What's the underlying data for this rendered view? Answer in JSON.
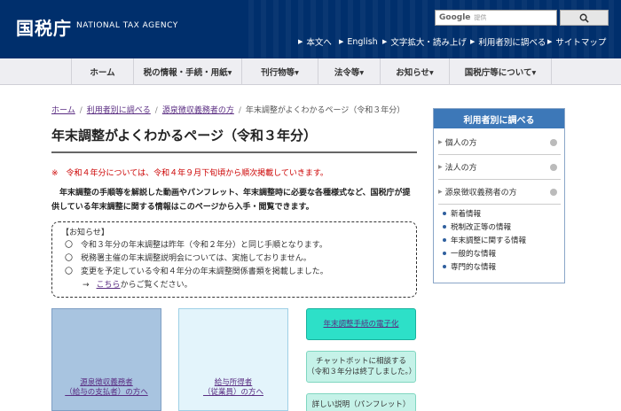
{
  "header": {
    "logo_jp": "国税庁",
    "logo_en": "NATIONAL TAX AGENCY",
    "search_brand": "Google",
    "search_placeholder": "提供",
    "util_links": [
      {
        "label": "本文へ"
      },
      {
        "label": "English"
      },
      {
        "label": "文字拡大・読み上げ"
      },
      {
        "label": "利用者別に調べる"
      },
      {
        "label": "サイトマップ"
      }
    ]
  },
  "nav": {
    "items": [
      {
        "label": "ホーム"
      },
      {
        "label": "税の情報・手続・用紙▾"
      },
      {
        "label": "刊行物等▾"
      },
      {
        "label": "法令等▾"
      },
      {
        "label": "お知らせ▾"
      },
      {
        "label": "国税庁等について▾"
      }
    ]
  },
  "breadcrumb": {
    "items": [
      "ホーム",
      "利用者別に調べる",
      "源泉徴収義務者の方"
    ],
    "current": "年末調整がよくわかるページ（令和３年分）"
  },
  "page": {
    "title": "年末調整がよくわかるページ（令和３年分）",
    "notice_red": "※　令和４年分については、令和４年９月下旬頃から順次掲載していきます。",
    "intro": "年末調整の手順等を解説した動画やパンフレット、年末調整時に必要な各種様式など、国税庁が提供している年末調整に関する情報はこのページから入手・閲覧できます。",
    "info_box": {
      "heading": "【お知らせ】",
      "rows": [
        {
          "mark": "〇",
          "text": "令和３年分の年末調整は昨年（令和２年分）と同じ手順となります。"
        },
        {
          "mark": "〇",
          "text": "税務署主催の年末調整説明会については、実施しておりません。"
        },
        {
          "mark": "〇",
          "text": "変更を予定している令和４年分の年末調整関係書類を掲載しました。"
        }
      ],
      "sub_arrow": "→",
      "sub_link": "こちら",
      "sub_suffix": "からご覧ください。"
    },
    "tiles": {
      "a_line1": "源泉徴収義務者",
      "a_line2": "（給与の支払者）の方へ",
      "b_line1": "給与所得者",
      "b_line2": "（従業員）の方へ",
      "btn1": "年末調整手続の電子化",
      "btn2_line1": "チャットボットに相談する",
      "btn2_line2": "（令和３年分は終了しました。）",
      "btn3": "詳しい説明（パンフレット）"
    }
  },
  "sidebar": {
    "heading": "利用者別に調べる",
    "items": [
      {
        "label": "個人の方"
      },
      {
        "label": "法人の方"
      },
      {
        "label": "源泉徴収義務者の方"
      }
    ],
    "subitems": [
      {
        "label": "新着情報"
      },
      {
        "label": "税制改正等の情報"
      },
      {
        "label": "年末調整に関する情報"
      },
      {
        "label": "一般的な情報"
      },
      {
        "label": "専門的な情報"
      }
    ]
  }
}
